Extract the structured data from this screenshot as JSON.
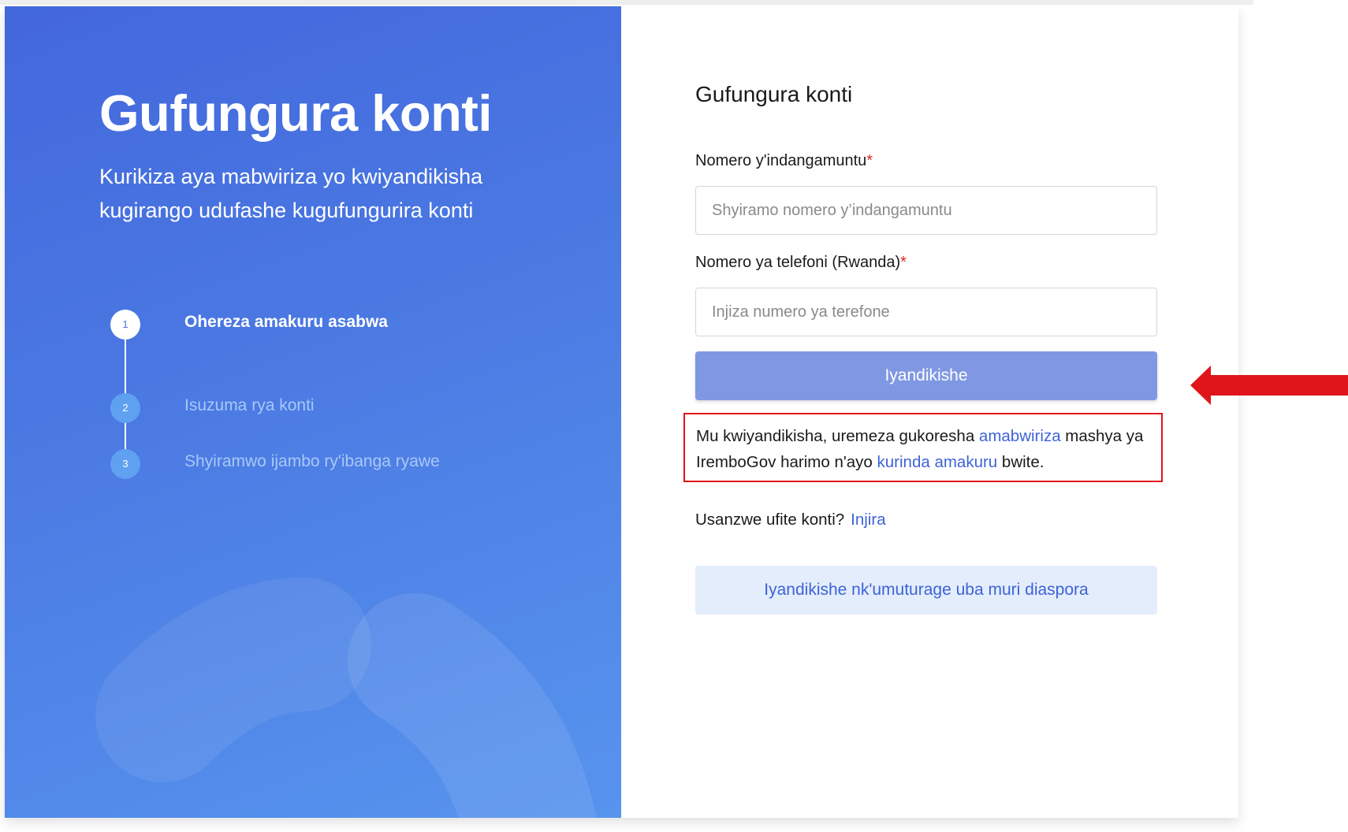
{
  "hero": {
    "title": "Gufungura konti",
    "subtitle": "Kurikiza aya mabwiriza yo kwiyandikisha kugirango udufashe kugufungurira konti"
  },
  "steps": [
    {
      "number": "1",
      "label": "Ohereza amakuru asabwa",
      "state": "active"
    },
    {
      "number": "2",
      "label": "Isuzuma rya konti",
      "state": "pending"
    },
    {
      "number": "3",
      "label": "Shyiramwo ijambo ry'ibanga ryawe",
      "state": "pending"
    }
  ],
  "form": {
    "title": "Gufungura konti",
    "id_label": "Nomero y'indangamuntu",
    "id_placeholder": "Shyiramo nomero y’indangamuntu",
    "phone_label": "Nomero ya telefoni (Rwanda)",
    "phone_placeholder": "Injiza numero ya terefone",
    "required_mark": "*",
    "submit_label": "Iyandikishe",
    "terms": {
      "part1": "Mu kwiyandikisha, uremeza gukoresha ",
      "link1": "amabwiriza",
      "part2": " mashya ya IremboGov harimo n'ayo ",
      "link2": "kurinda amakuru",
      "part3": " bwite."
    },
    "login_prompt": "Usanzwe ufite konti?",
    "login_link": "Injira",
    "diaspora_label": "Iyandikishe nk'umuturage uba muri diaspora"
  },
  "colors": {
    "accent": "#3d63d8",
    "highlight_box": "#e0151b",
    "annotation_arrow": "#e0151b"
  }
}
